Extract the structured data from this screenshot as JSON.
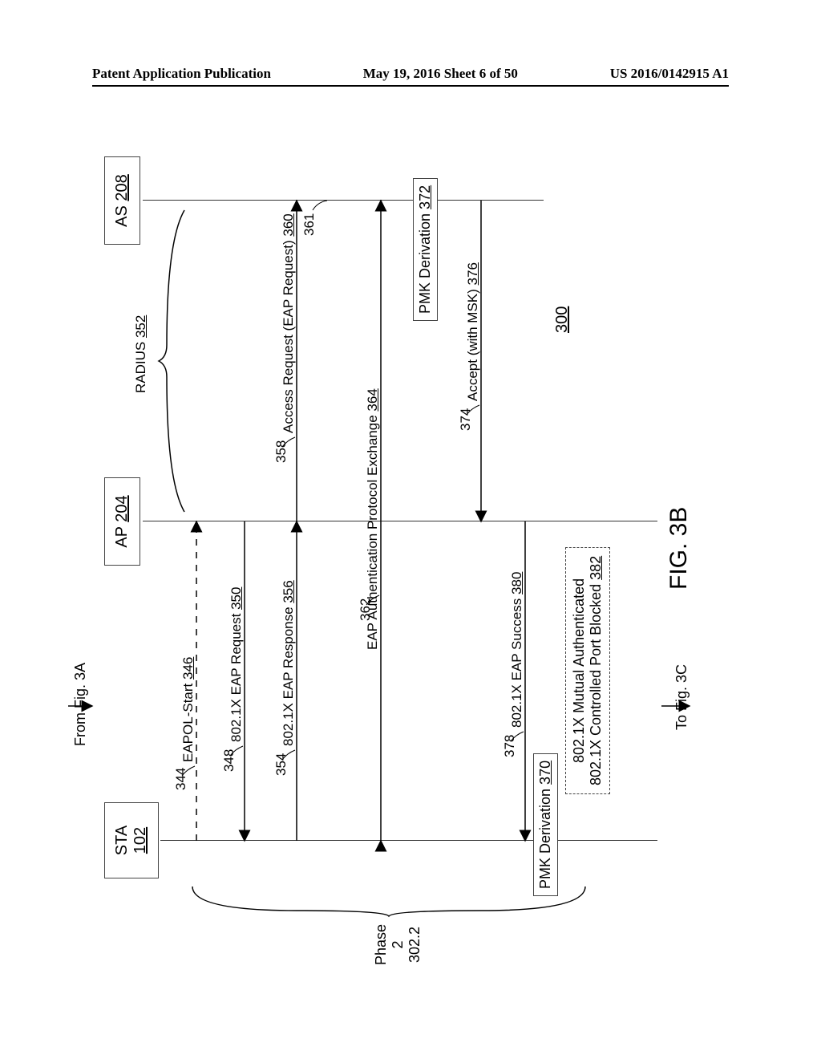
{
  "header": {
    "left": "Patent Application Publication",
    "center": "May 19, 2016  Sheet 6 of 50",
    "right": "US 2016/0142915 A1"
  },
  "entities": {
    "sta": {
      "name": "STA",
      "num": "102"
    },
    "ap": {
      "name": "AP",
      "num": "204"
    },
    "as": {
      "name": "AS",
      "num": "208"
    }
  },
  "connectors": {
    "from": "From Fig. 3A",
    "to": "To Fig. 3C"
  },
  "radius": {
    "label": "RADIUS",
    "num": "352"
  },
  "messages": {
    "eapol_start": {
      "text": "EAPOL-Start",
      "num_inline": "346",
      "hook": "344"
    },
    "eap_request": {
      "text": "802.1X EAP Request",
      "num_inline": "350",
      "hook": "348"
    },
    "eap_response": {
      "text": "802.1X EAP Response",
      "num_inline": "356",
      "hook": "354"
    },
    "access_request": {
      "text": "Access Request (EAP Request)",
      "num_inline": "360",
      "hook": "358"
    },
    "eap_exchange": {
      "text": "EAP Authentication Protocol Exchange",
      "num_inline": "364",
      "hook": "362",
      "hook2": "361"
    },
    "accept": {
      "text": "Accept (with MSK)",
      "num_inline": "376",
      "hook": "374"
    },
    "eap_success": {
      "text": "802.1X EAP Success",
      "num_inline": "380",
      "hook": "378"
    }
  },
  "pmk_sta": {
    "label": "PMK Derivation",
    "num": "370"
  },
  "pmk_as": {
    "label": "PMK Derivation",
    "num": "372"
  },
  "status_box": {
    "line1": "802.1X Mutual Authenticated",
    "line2_pre": "802.1X Controlled Port Blocked",
    "line2_num": "382"
  },
  "phase": {
    "label": "Phase 2",
    "num": "302.2"
  },
  "figure_ref": "300",
  "figure_label": "FIG. 3B"
}
